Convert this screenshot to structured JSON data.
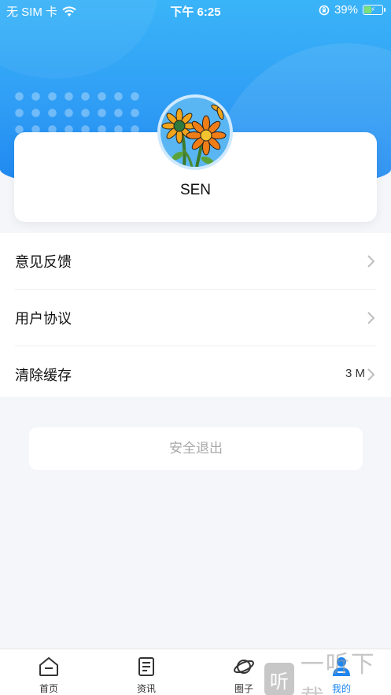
{
  "status_bar": {
    "carrier": "无 SIM 卡",
    "time": "下午 6:25",
    "battery": "39%",
    "icons": [
      "wifi-icon",
      "orientation-lock-icon",
      "battery-charging-icon"
    ]
  },
  "profile": {
    "username": "SEN",
    "avatar": "sunflower-avatar"
  },
  "menu": {
    "items": [
      {
        "label": "意见反馈",
        "value": ""
      },
      {
        "label": "用户协议",
        "value": ""
      },
      {
        "label": "清除缓存",
        "value": "3 M"
      }
    ]
  },
  "logout_label": "安全退出",
  "tabbar": {
    "tabs": [
      {
        "label": "首页",
        "icon": "home-icon"
      },
      {
        "label": "资讯",
        "icon": "news-icon"
      },
      {
        "label": "圈子",
        "icon": "planet-icon"
      },
      {
        "label": "我的",
        "icon": "user-icon",
        "active": true
      }
    ]
  },
  "watermark": {
    "glyph": "听",
    "text": "一听下载"
  },
  "colors": {
    "brand": "#2f9df5",
    "active_tab": "#1e86f0",
    "background": "#f5f6fa"
  }
}
